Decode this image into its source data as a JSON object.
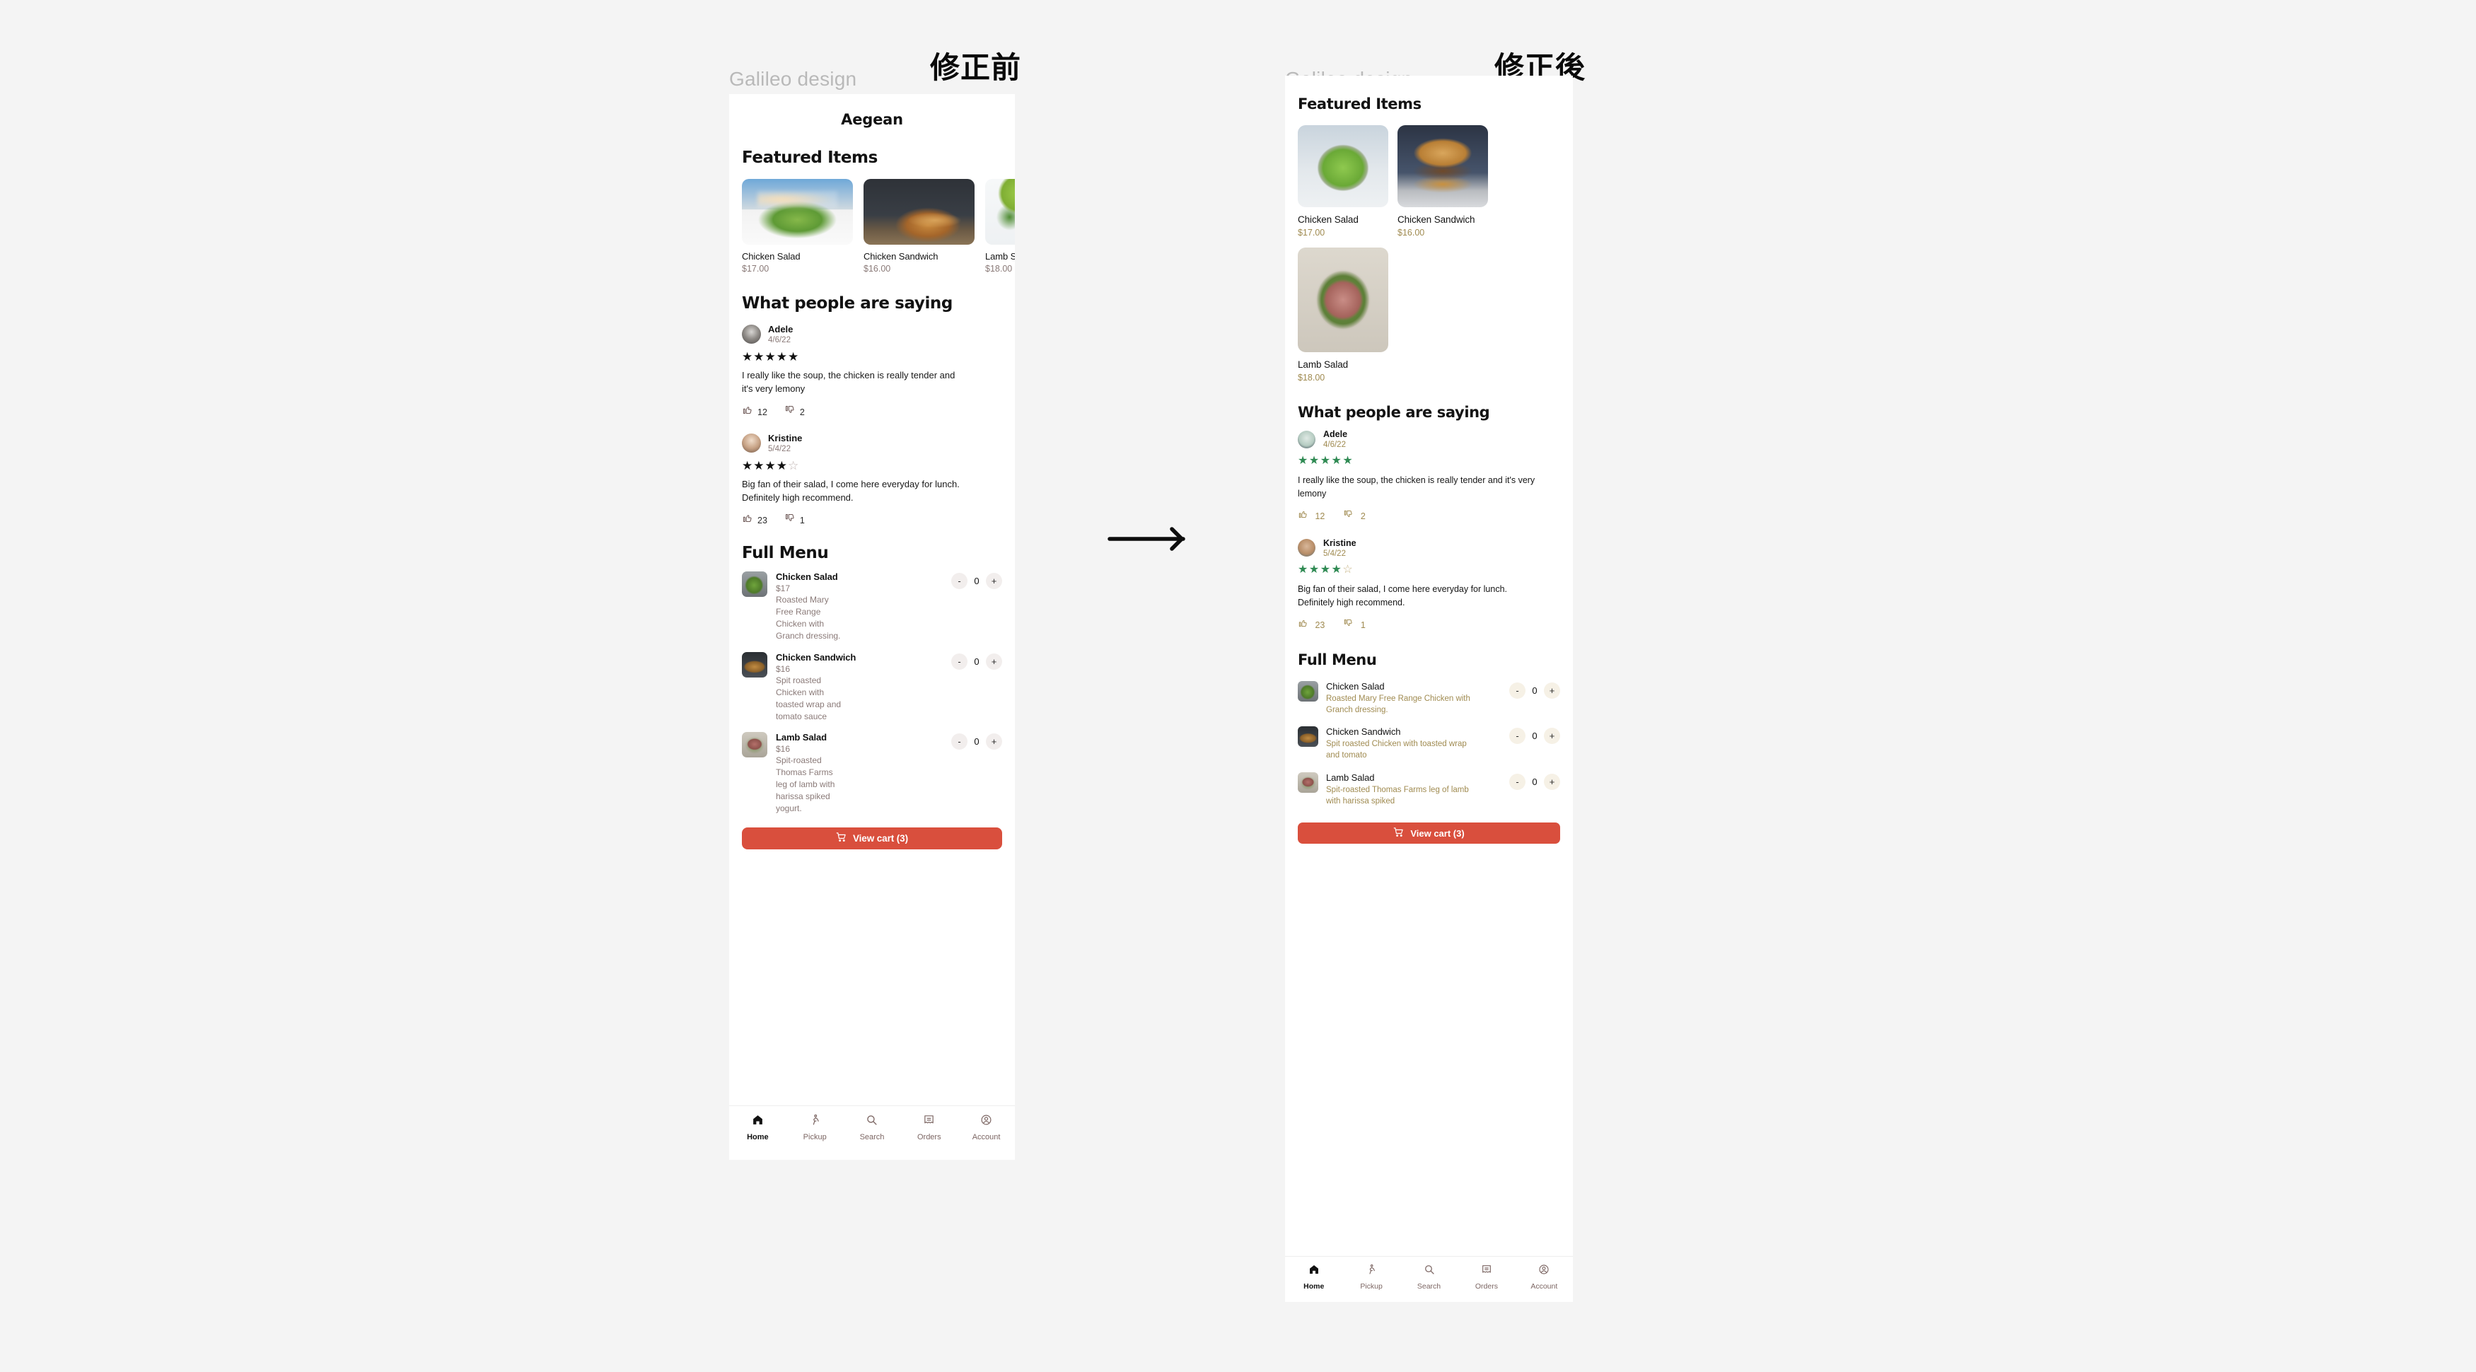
{
  "panels": {
    "before": {
      "section_label": "修正前",
      "brand": "Galileo design",
      "restaurant_title": "Aegean",
      "featured_heading": "Featured Items",
      "featured_items": [
        {
          "name": "Chicken Salad",
          "price": "$17.00",
          "image": "ph-salad-sky"
        },
        {
          "name": "Chicken Sandwich",
          "price": "$16.00",
          "image": "ph-burger-dark"
        },
        {
          "name": "Lamb Salad",
          "price": "$18.00",
          "image": "ph-lime-white"
        }
      ],
      "reviews_heading": "What people are saying",
      "reviews": [
        {
          "name": "Adele",
          "date": "4/6/22",
          "stars_filled": 5,
          "stars_total": 5,
          "text": "I really like the soup, the chicken is really tender and it's very lemony",
          "likes": "12",
          "dislikes": "2",
          "avatar": "ph-av-mono"
        },
        {
          "name": "Kristine",
          "date": "5/4/22",
          "stars_filled": 4,
          "stars_total": 5,
          "text": "Big fan of their salad, I come here everyday for lunch. Definitely high recommend.",
          "likes": "23",
          "dislikes": "1",
          "avatar": "ph-av-kristine"
        }
      ],
      "menu_heading": "Full Menu",
      "menu_items": [
        {
          "name": "Chicken Salad",
          "price": "$17",
          "desc": "Roasted Mary Free Range Chicken with Granch dressing.",
          "qty": "0",
          "minus": "-",
          "plus": "+",
          "image": "ph-thumb-salad"
        },
        {
          "name": "Chicken Sandwich",
          "price": "$16",
          "desc": "Spit roasted Chicken with toasted wrap and tomato sauce",
          "qty": "0",
          "minus": "-",
          "plus": "+",
          "image": "ph-thumb-burger"
        },
        {
          "name": "Lamb Salad",
          "price": "$16",
          "desc": "Spit-roasted Thomas Farms leg of lamb with harissa spiked yogurt.",
          "qty": "0",
          "minus": "-",
          "plus": "+",
          "image": "ph-thumb-lamb"
        }
      ],
      "cart_label": "View cart (3)",
      "tabs": [
        {
          "label": "Home",
          "icon": "home-icon",
          "active": true
        },
        {
          "label": "Pickup",
          "icon": "walking-person-icon",
          "active": false
        },
        {
          "label": "Search",
          "icon": "search-icon",
          "active": false
        },
        {
          "label": "Orders",
          "icon": "receipt-icon",
          "active": false
        },
        {
          "label": "Account",
          "icon": "account-circle-icon",
          "active": false
        }
      ]
    },
    "after": {
      "section_label": "修正後",
      "brand": "Galileo design",
      "featured_heading": "Featured Items",
      "featured_items": [
        {
          "name": "Chicken Salad",
          "price": "$17.00",
          "image": "ph-cloud-salad"
        },
        {
          "name": "Chicken Sandwich",
          "price": "$16.00",
          "image": "ph-burger-blue"
        },
        {
          "name": "Lamb Salad",
          "price": "$18.00",
          "image": "ph-lamb-plate"
        }
      ],
      "reviews_heading": "What people are saying",
      "reviews": [
        {
          "name": "Adele",
          "date": "4/6/22",
          "stars_filled": 5,
          "stars_total": 5,
          "text": "I really like the soup, the chicken is really tender and it's very lemony",
          "likes": "12",
          "dislikes": "2",
          "avatar": "ph-av-adele2"
        },
        {
          "name": "Kristine",
          "date": "5/4/22",
          "stars_filled": 4,
          "stars_total": 5,
          "text": "Big fan of their salad, I come here everyday for lunch. Definitely high recommend.",
          "likes": "23",
          "dislikes": "1",
          "avatar": "ph-av-kris2"
        }
      ],
      "menu_heading": "Full Menu",
      "menu_items": [
        {
          "name": "Chicken Salad",
          "desc": "Roasted Mary Free Range Chicken with Granch dressing.",
          "qty": "0",
          "minus": "-",
          "plus": "+",
          "image": "ph-thumb-salad"
        },
        {
          "name": "Chicken Sandwich",
          "desc": "Spit roasted Chicken with toasted wrap and tomato",
          "qty": "0",
          "minus": "-",
          "plus": "+",
          "image": "ph-thumb-burger"
        },
        {
          "name": "Lamb Salad",
          "desc": "Spit-roasted Thomas Farms leg of lamb with harissa spiked",
          "qty": "0",
          "minus": "-",
          "plus": "+",
          "image": "ph-thumb-lamb"
        }
      ],
      "cart_label": "View cart (3)",
      "tabs": [
        {
          "label": "Home",
          "icon": "home-icon",
          "active": true
        },
        {
          "label": "Pickup",
          "icon": "walking-person-icon",
          "active": false
        },
        {
          "label": "Search",
          "icon": "search-icon",
          "active": false
        },
        {
          "label": "Orders",
          "icon": "receipt-icon",
          "active": false
        },
        {
          "label": "Account",
          "icon": "account-circle-icon",
          "active": false
        }
      ]
    }
  },
  "colors": {
    "background": "#f4f4f4",
    "card": "#ffffff",
    "accent_red": "#d94f3d",
    "before_muted": "#8a7a78",
    "after_muted": "#a08b51",
    "after_star_green": "#2f8a53",
    "stepper_before": "#f2eeed",
    "stepper_after": "#f6f1e6",
    "brand_gray": "#b9b9b9"
  },
  "arrow": {
    "direction": "right"
  }
}
